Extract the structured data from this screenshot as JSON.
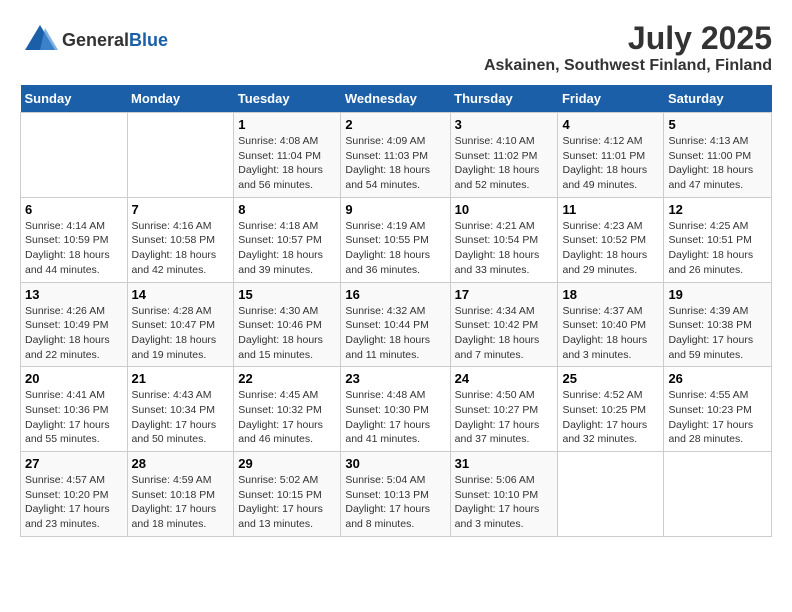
{
  "header": {
    "logo_general": "General",
    "logo_blue": "Blue",
    "month_title": "July 2025",
    "location": "Askainen, Southwest Finland, Finland"
  },
  "days_of_week": [
    "Sunday",
    "Monday",
    "Tuesday",
    "Wednesday",
    "Thursday",
    "Friday",
    "Saturday"
  ],
  "weeks": [
    [
      {
        "day": "",
        "info": ""
      },
      {
        "day": "",
        "info": ""
      },
      {
        "day": "1",
        "info": "Sunrise: 4:08 AM\nSunset: 11:04 PM\nDaylight: 18 hours\nand 56 minutes."
      },
      {
        "day": "2",
        "info": "Sunrise: 4:09 AM\nSunset: 11:03 PM\nDaylight: 18 hours\nand 54 minutes."
      },
      {
        "day": "3",
        "info": "Sunrise: 4:10 AM\nSunset: 11:02 PM\nDaylight: 18 hours\nand 52 minutes."
      },
      {
        "day": "4",
        "info": "Sunrise: 4:12 AM\nSunset: 11:01 PM\nDaylight: 18 hours\nand 49 minutes."
      },
      {
        "day": "5",
        "info": "Sunrise: 4:13 AM\nSunset: 11:00 PM\nDaylight: 18 hours\nand 47 minutes."
      }
    ],
    [
      {
        "day": "6",
        "info": "Sunrise: 4:14 AM\nSunset: 10:59 PM\nDaylight: 18 hours\nand 44 minutes."
      },
      {
        "day": "7",
        "info": "Sunrise: 4:16 AM\nSunset: 10:58 PM\nDaylight: 18 hours\nand 42 minutes."
      },
      {
        "day": "8",
        "info": "Sunrise: 4:18 AM\nSunset: 10:57 PM\nDaylight: 18 hours\nand 39 minutes."
      },
      {
        "day": "9",
        "info": "Sunrise: 4:19 AM\nSunset: 10:55 PM\nDaylight: 18 hours\nand 36 minutes."
      },
      {
        "day": "10",
        "info": "Sunrise: 4:21 AM\nSunset: 10:54 PM\nDaylight: 18 hours\nand 33 minutes."
      },
      {
        "day": "11",
        "info": "Sunrise: 4:23 AM\nSunset: 10:52 PM\nDaylight: 18 hours\nand 29 minutes."
      },
      {
        "day": "12",
        "info": "Sunrise: 4:25 AM\nSunset: 10:51 PM\nDaylight: 18 hours\nand 26 minutes."
      }
    ],
    [
      {
        "day": "13",
        "info": "Sunrise: 4:26 AM\nSunset: 10:49 PM\nDaylight: 18 hours\nand 22 minutes."
      },
      {
        "day": "14",
        "info": "Sunrise: 4:28 AM\nSunset: 10:47 PM\nDaylight: 18 hours\nand 19 minutes."
      },
      {
        "day": "15",
        "info": "Sunrise: 4:30 AM\nSunset: 10:46 PM\nDaylight: 18 hours\nand 15 minutes."
      },
      {
        "day": "16",
        "info": "Sunrise: 4:32 AM\nSunset: 10:44 PM\nDaylight: 18 hours\nand 11 minutes."
      },
      {
        "day": "17",
        "info": "Sunrise: 4:34 AM\nSunset: 10:42 PM\nDaylight: 18 hours\nand 7 minutes."
      },
      {
        "day": "18",
        "info": "Sunrise: 4:37 AM\nSunset: 10:40 PM\nDaylight: 18 hours\nand 3 minutes."
      },
      {
        "day": "19",
        "info": "Sunrise: 4:39 AM\nSunset: 10:38 PM\nDaylight: 17 hours\nand 59 minutes."
      }
    ],
    [
      {
        "day": "20",
        "info": "Sunrise: 4:41 AM\nSunset: 10:36 PM\nDaylight: 17 hours\nand 55 minutes."
      },
      {
        "day": "21",
        "info": "Sunrise: 4:43 AM\nSunset: 10:34 PM\nDaylight: 17 hours\nand 50 minutes."
      },
      {
        "day": "22",
        "info": "Sunrise: 4:45 AM\nSunset: 10:32 PM\nDaylight: 17 hours\nand 46 minutes."
      },
      {
        "day": "23",
        "info": "Sunrise: 4:48 AM\nSunset: 10:30 PM\nDaylight: 17 hours\nand 41 minutes."
      },
      {
        "day": "24",
        "info": "Sunrise: 4:50 AM\nSunset: 10:27 PM\nDaylight: 17 hours\nand 37 minutes."
      },
      {
        "day": "25",
        "info": "Sunrise: 4:52 AM\nSunset: 10:25 PM\nDaylight: 17 hours\nand 32 minutes."
      },
      {
        "day": "26",
        "info": "Sunrise: 4:55 AM\nSunset: 10:23 PM\nDaylight: 17 hours\nand 28 minutes."
      }
    ],
    [
      {
        "day": "27",
        "info": "Sunrise: 4:57 AM\nSunset: 10:20 PM\nDaylight: 17 hours\nand 23 minutes."
      },
      {
        "day": "28",
        "info": "Sunrise: 4:59 AM\nSunset: 10:18 PM\nDaylight: 17 hours\nand 18 minutes."
      },
      {
        "day": "29",
        "info": "Sunrise: 5:02 AM\nSunset: 10:15 PM\nDaylight: 17 hours\nand 13 minutes."
      },
      {
        "day": "30",
        "info": "Sunrise: 5:04 AM\nSunset: 10:13 PM\nDaylight: 17 hours\nand 8 minutes."
      },
      {
        "day": "31",
        "info": "Sunrise: 5:06 AM\nSunset: 10:10 PM\nDaylight: 17 hours\nand 3 minutes."
      },
      {
        "day": "",
        "info": ""
      },
      {
        "day": "",
        "info": ""
      }
    ]
  ]
}
